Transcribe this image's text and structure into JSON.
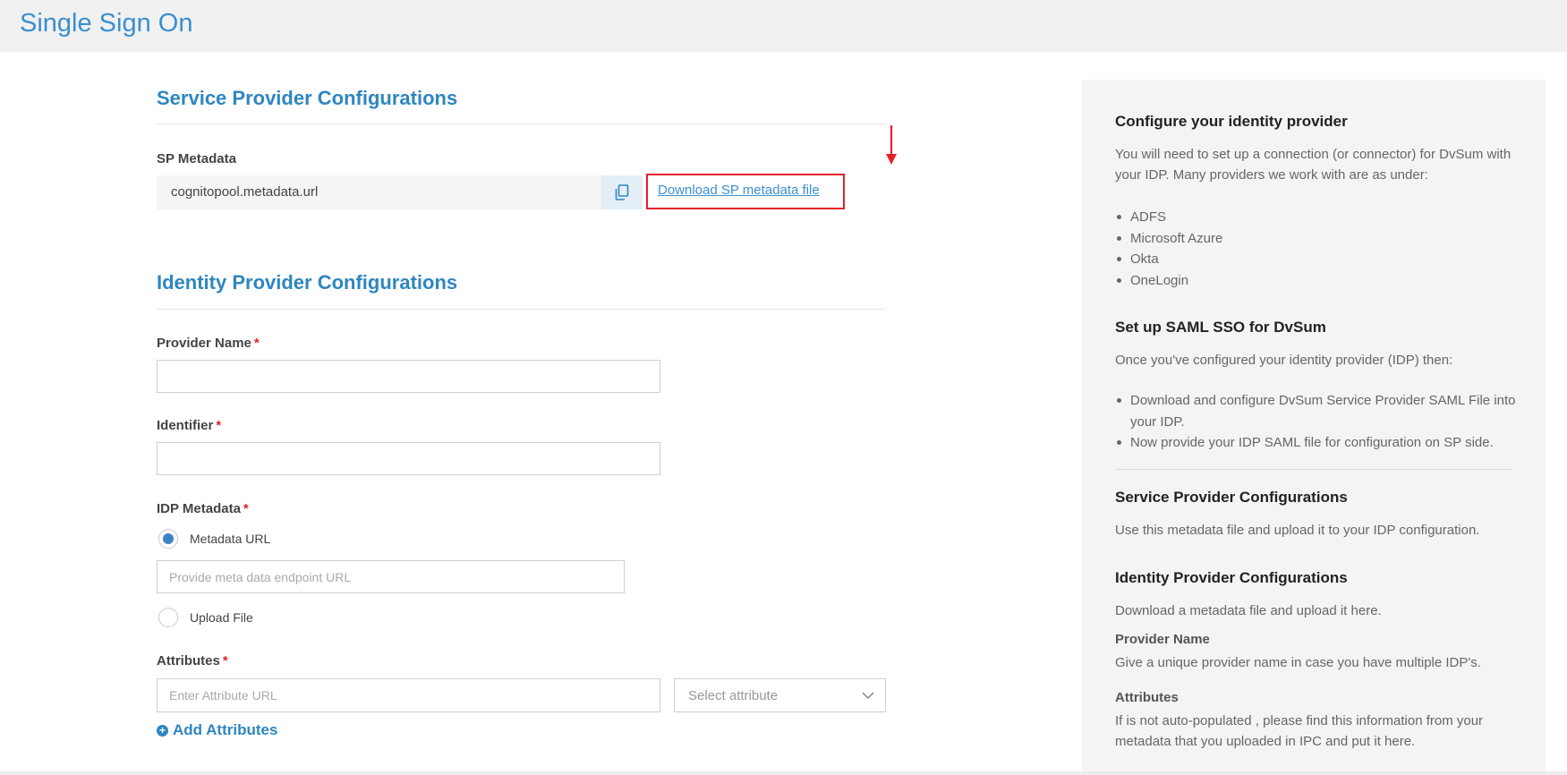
{
  "header": {
    "title": "Single Sign On"
  },
  "service_provider": {
    "title": "Service Provider Configurations",
    "sp_metadata_label": "SP Metadata",
    "sp_metadata_value": "cognitopool.metadata.url",
    "download_link": "Download SP metadata file"
  },
  "identity_provider": {
    "title": "Identity Provider Configurations",
    "provider_name_label": "Provider Name",
    "identifier_label": "Identifier",
    "idp_metadata_label": "IDP Metadata",
    "required_mark": "*",
    "metadata_url_option": "Metadata URL",
    "metadata_url_placeholder": "Provide meta data endpoint URL",
    "upload_file_option": "Upload File",
    "attributes_label": "Attributes",
    "attribute_url_placeholder": "Enter Attribute URL",
    "select_attribute": "Select attribute",
    "add_attributes": "Add Attributes",
    "selected_option": "Metadata URL"
  },
  "sidebar": {
    "configure_title": "Configure your identity provider",
    "configure_text": "You will need to set up a connection (or connector) for DvSum with your IDP. Many providers we work with are as under:",
    "providers": [
      "ADFS",
      "Microsoft Azure",
      "Okta",
      "OneLogin"
    ],
    "saml_title": "Set up SAML SSO for DvSum",
    "saml_text": "Once you've configured your identity provider (IDP) then:",
    "saml_steps": [
      "Download and configure DvSum Service Provider SAML File into your IDP.",
      "Now provide your IDP SAML file for configuration on SP side."
    ],
    "sp_title": "Service Provider Configurations",
    "sp_text": "Use this metadata file and upload it to your IDP configuration.",
    "idp_title": "Identity Provider Configurations",
    "idp_text": "Download a metadata file and upload it here.",
    "provider_name_title": "Provider Name",
    "provider_name_text": "Give a unique provider name in case you have multiple IDP's.",
    "attributes_title": "Attributes",
    "attributes_text": "If is not auto-populated , please find this information from your metadata that you uploaded in IPC and put it here."
  },
  "colors": {
    "accent": "#2f86c0",
    "highlight": "#e5212a",
    "required": "#e0262b"
  }
}
